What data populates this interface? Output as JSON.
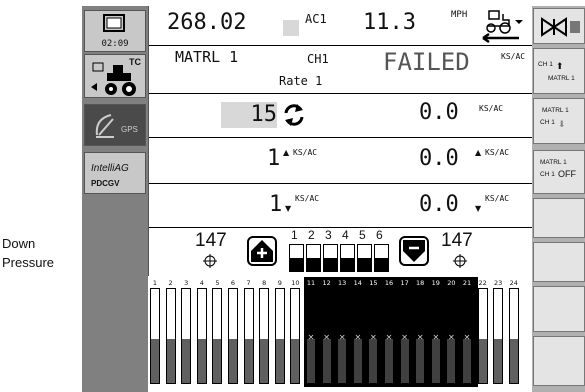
{
  "callout": {
    "line1": "Down",
    "line2": "Pressure"
  },
  "left_panel": {
    "time": "02:09",
    "tc_label": "TC",
    "gps_label": "GPS",
    "intelliag_label": "IntelliAG",
    "pdcgv_label": "PDCGV"
  },
  "header": {
    "speed": "268.02",
    "ac_label": "AC1",
    "mph_value": "11.3",
    "mph_unit": "MPH"
  },
  "material": {
    "name": "MATRL 1",
    "channel": "CH1",
    "status": "FAILED",
    "status_unit": "KS/AC",
    "rate_label": "Rate 1"
  },
  "rates": {
    "target": "15",
    "actual1": "0.0",
    "unit": "KS/AC",
    "step_up": "1",
    "actual2": "0.0",
    "step_down": "1",
    "actual3": "0.0"
  },
  "down_pressure": {
    "left_value": "147",
    "right_value": "147",
    "gauges": [
      {
        "label": "1",
        "level": 0.5
      },
      {
        "label": "2",
        "level": 0.5
      },
      {
        "label": "3",
        "level": 0.5
      },
      {
        "label": "4",
        "level": 0.5
      },
      {
        "label": "5",
        "level": 0.5
      },
      {
        "label": "6",
        "level": 0.5
      }
    ]
  },
  "sections": {
    "count": 24,
    "labels": [
      "1",
      "2",
      "3",
      "4",
      "5",
      "6",
      "7",
      "8",
      "9",
      "10",
      "11",
      "12",
      "13",
      "14",
      "15",
      "16",
      "17",
      "18",
      "19",
      "20",
      "21",
      "22",
      "23",
      "24"
    ],
    "active": [
      11,
      12,
      13,
      14,
      15,
      16,
      17,
      18,
      19,
      20,
      21
    ]
  },
  "right_panel": {
    "btn2": {
      "line1": "CH 1",
      "line2": "MATRL 1"
    },
    "btn3": {
      "line1": "MATRL 1",
      "line2": "CH 1"
    },
    "btn4": {
      "line1": "MATRL 1",
      "line2": "CH 1",
      "line3": "OFF"
    }
  },
  "colors": {
    "background": "#ffffff",
    "panel_gray": "#808080",
    "button_gray": "#c8c8c8",
    "active_section": "#000000"
  }
}
